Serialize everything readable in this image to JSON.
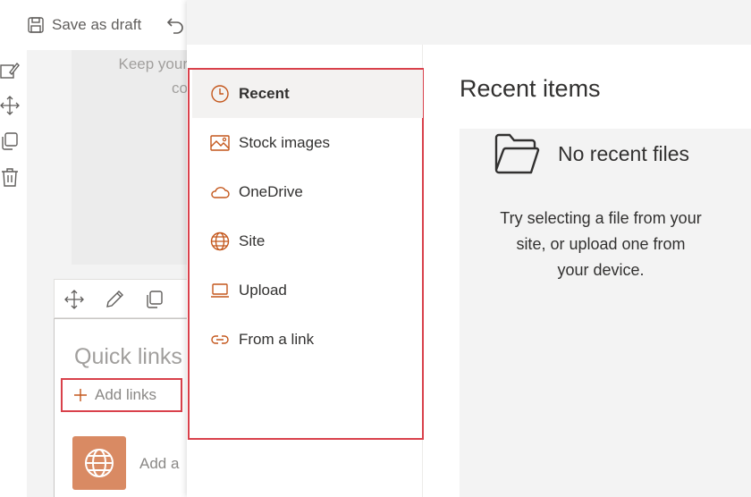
{
  "toolbar": {
    "save_draft_label": "Save as draft",
    "icons": [
      "save-icon",
      "undo-icon"
    ]
  },
  "left_rail": {
    "icons": [
      "edit-icon",
      "move-icon",
      "copy-icon",
      "delete-icon"
    ]
  },
  "text_webpart": {
    "lines": [
      "Keep your",
      "co"
    ]
  },
  "quick_links": {
    "toolbar_icons": [
      "move-icon",
      "edit-icon",
      "copy-icon"
    ],
    "title": "Quick links",
    "add_links_label": "Add links",
    "item_text": "Add a"
  },
  "picker": {
    "nav_items": [
      {
        "label": "Recent",
        "icon": "clock-icon",
        "active": true
      },
      {
        "label": "Stock images",
        "icon": "image-icon",
        "active": false
      },
      {
        "label": "OneDrive",
        "icon": "cloud-icon",
        "active": false
      },
      {
        "label": "Site",
        "icon": "globe-icon",
        "active": false
      },
      {
        "label": "Upload",
        "icon": "laptop-icon",
        "active": false
      },
      {
        "label": "From a link",
        "icon": "link-icon",
        "active": false
      }
    ],
    "main": {
      "title": "Recent items",
      "empty_title": "No recent files",
      "empty_hint_lines": [
        "Try selecting a file from your",
        "site, or upload one from",
        "your device."
      ]
    }
  },
  "colors": {
    "accent": "#c4571c",
    "highlight_border": "#d9414b",
    "tile": "#d98a63"
  }
}
